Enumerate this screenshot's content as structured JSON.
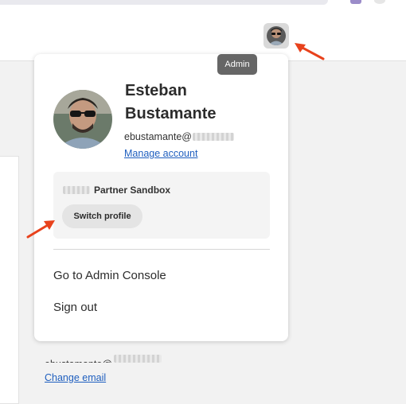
{
  "header": {
    "avatar_button_icon": "user-avatar-icon",
    "tooltip": "Admin"
  },
  "profile_menu": {
    "name": "Esteban Bustamante",
    "email_prefix": "ebustamante@",
    "manage_account": "Manage account",
    "org": {
      "name": "Partner Sandbox",
      "switch_profile": "Switch profile"
    },
    "menu_items": [
      {
        "label": "Go to Admin Console"
      },
      {
        "label": "Sign out"
      }
    ]
  },
  "page": {
    "email_prefix": "ebustamante@",
    "change_email": "Change email"
  },
  "colors": {
    "accent_link": "#1f5fbf",
    "annotation_arrow": "#e8421c"
  }
}
